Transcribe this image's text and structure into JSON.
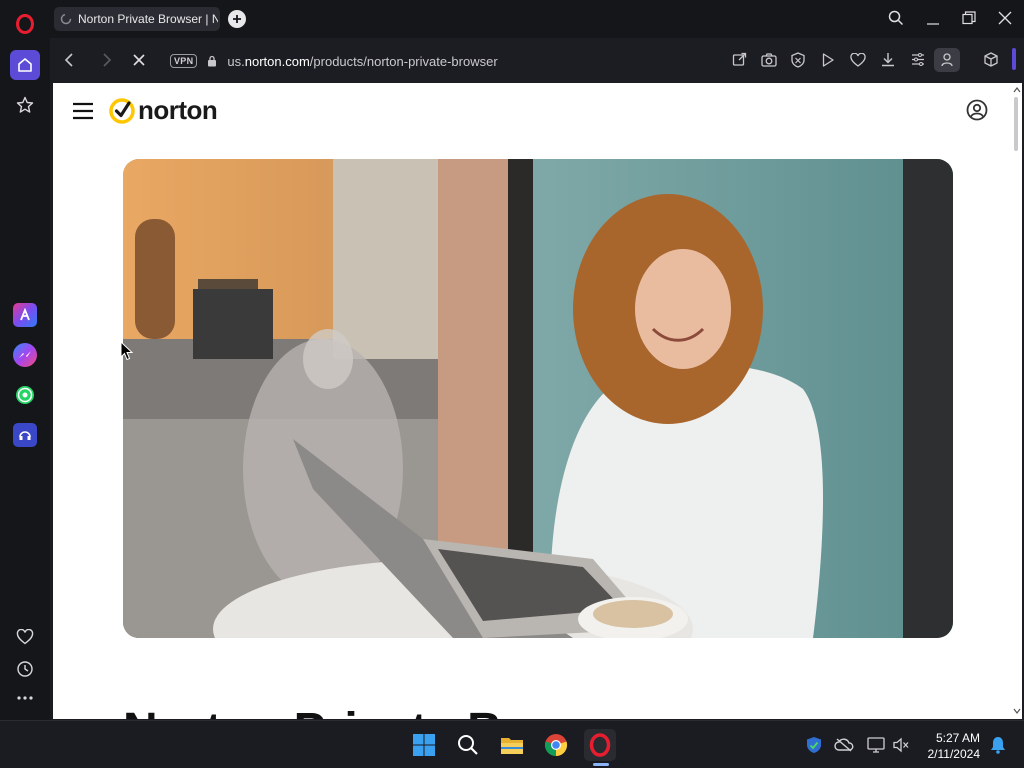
{
  "tab": {
    "title": "Norton Private Browser | N"
  },
  "address": {
    "vpn_label": "VPN",
    "url_prefix": "us.",
    "url_domain": "norton.com",
    "url_path": "/products/norton-private-browser"
  },
  "page": {
    "brand": "norton",
    "heading_partial": "Norton Private B"
  },
  "taskbar": {
    "time": "5:27 AM",
    "date": "2/11/2024"
  },
  "colors": {
    "opera_red": "#e81e30",
    "norton_yellow": "#ffc700",
    "accent": "#5b4bd6"
  }
}
